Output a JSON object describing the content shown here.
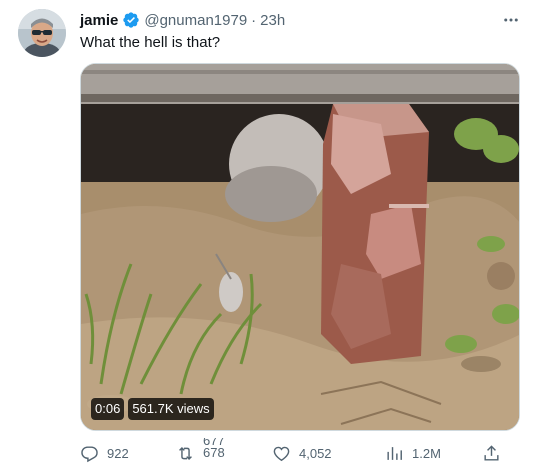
{
  "tweet": {
    "author": {
      "name": "jamie",
      "handle": "@gnuman1979",
      "separator": "·",
      "time": "23h",
      "verified": true
    },
    "text": "What the hell is that?",
    "media": {
      "duration": "0:06",
      "views": "561.7K views"
    },
    "actions": {
      "replies": "922",
      "retweets_old": "677",
      "retweets_new": "678",
      "likes": "4,052",
      "views": "1.2M"
    }
  },
  "icons": {
    "more": "more-icon",
    "verified": "verified-badge-icon",
    "reply": "reply-icon",
    "retweet": "retweet-icon",
    "like": "heart-icon",
    "views": "analytics-icon",
    "share": "share-icon"
  },
  "colors": {
    "text_primary": "#0f1419",
    "text_secondary": "#536471",
    "verified_blue": "#1d9bf0",
    "border": "#cfd9de"
  }
}
